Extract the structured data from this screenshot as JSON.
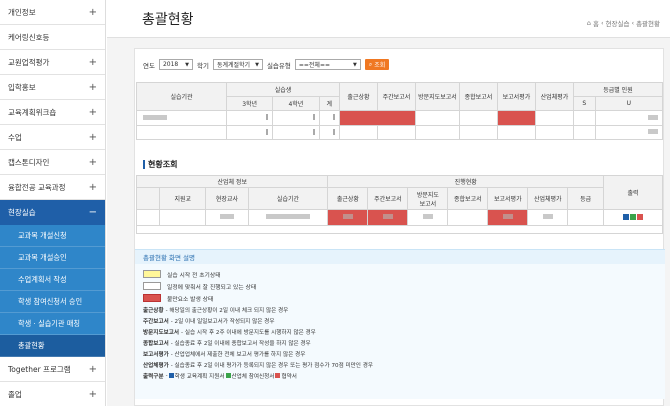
{
  "sidebar": {
    "items": [
      {
        "label": "개인정보",
        "plus": "+"
      },
      {
        "label": "케어링신호등",
        "plus": ""
      },
      {
        "label": "교원업적평가",
        "plus": "+"
      },
      {
        "label": "입학홍보",
        "plus": "+"
      },
      {
        "label": "교육계획위크숍",
        "plus": "+"
      },
      {
        "label": "수업",
        "plus": "+"
      },
      {
        "label": "캡스톤디자인",
        "plus": "+"
      },
      {
        "label": "융합전공 교육과정",
        "plus": "+"
      }
    ],
    "active": {
      "label": "현장실습",
      "minus": "−"
    },
    "sub_items": [
      {
        "label": "교과목 개설신청"
      },
      {
        "label": "교과목 개설승인"
      },
      {
        "label": "수업계획서 작성"
      },
      {
        "label": "학생 참여신청서 승인"
      },
      {
        "label": "학생 · 실습기관 매칭"
      },
      {
        "label": "총괄현황"
      }
    ],
    "after": [
      {
        "label": "Together 프로그램",
        "plus": "+"
      },
      {
        "label": "졸업",
        "plus": "+"
      }
    ]
  },
  "header": {
    "title": "총괄현황",
    "breadcrumb": [
      "홈",
      "현장실습",
      "총괄현황"
    ]
  },
  "filter": {
    "year_label": "연도",
    "year_value": "2018",
    "term_label": "학기",
    "term_value": "동계계절학기",
    "type_label": "실습유형",
    "type_value": "==전체==",
    "search_label": "조회"
  },
  "summary_table": {
    "h_agency": "실습기관",
    "h_students": "실습생",
    "h_3": "3학년",
    "h_4": "4학년",
    "h_total": "계",
    "h_attend": "출근상황",
    "h_weekly": "주간보고서",
    "h_visit": "방문지도보고서",
    "h_final": "종합보고서",
    "h_report": "보고서평가",
    "h_eval": "산업체평가",
    "h_grade": "등급별 인원",
    "h_s": "S",
    "h_u": "U"
  },
  "status_section": {
    "title": "현황조회",
    "h_info": "산업체 정보",
    "h_progress": "진행현황",
    "h_output": "출력",
    "h_prof": "지원교",
    "h_field": "현장교사",
    "h_period": "실습기간",
    "h_attend": "출근상황",
    "h_weekly": "주간보고서",
    "h_visit": "방문지도\n보고서",
    "h_final": "종합보고서",
    "h_report": "보고서평가",
    "h_eval": "산업체평가",
    "h_grade": "등급"
  },
  "legend": {
    "title": "총괄현황 화면 설명",
    "chips": [
      {
        "label": "실습 시작 전 초기상태",
        "color": "#fff799"
      },
      {
        "label": "일정에 맞춰서 잘 진행되고 있는 상태",
        "color": "#ffffff"
      },
      {
        "label": "불만요소 발생 상태",
        "color": "#d9534f"
      }
    ],
    "descs": [
      {
        "name": "출근상황",
        "text": "- 해당일의 출근상황이 2일 이내 체크 되지 않은 경우"
      },
      {
        "name": "주간보고서",
        "text": "- 2일 이내 일일보고서가 작성되지 않은 경우"
      },
      {
        "name": "방문지도보고서",
        "text": "- 실습 시작 후 2주 이내에 방문지도를 시행하지 않은 경우"
      },
      {
        "name": "종합보고서",
        "text": "- 실습종료 후 2일 이내에 종합보고서 작성을 하지 않은 경우"
      },
      {
        "name": "보고서평가",
        "text": "- 산업업체에서 제출한 전체 보고서 평가를 하지 않은 경우"
      },
      {
        "name": "산업체평가",
        "text": "- 실습종료 후 2일 이내 평가가 등록되지 않은 경우 또는 평가 점수가 70점 미만인 경우"
      }
    ],
    "output": {
      "name": "출력구분",
      "items": [
        {
          "label": "학생 교육계획 지원서",
          "color": "#1f5fa8"
        },
        {
          "label": "산업체 참여신청서",
          "color": "#3aa34a"
        },
        {
          "label": "협약서",
          "color": "#d9534f"
        }
      ]
    }
  }
}
